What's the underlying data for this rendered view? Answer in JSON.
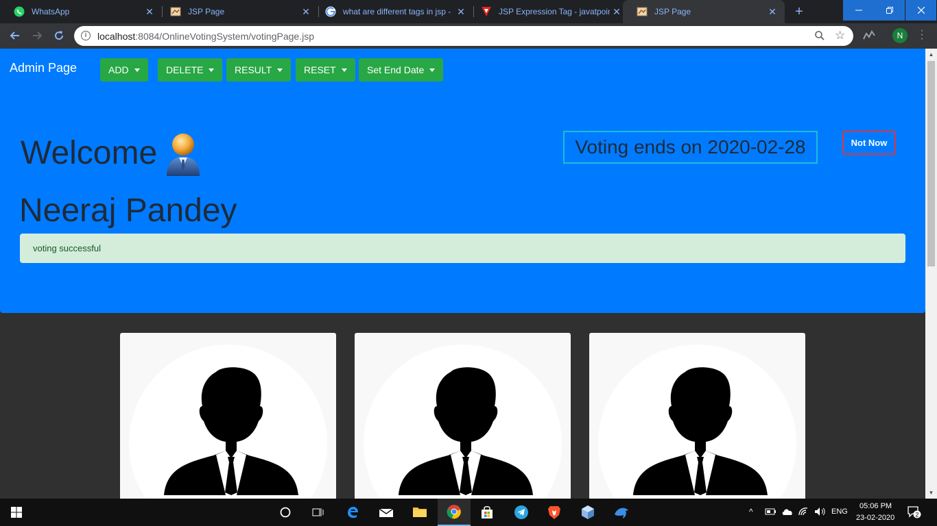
{
  "browser": {
    "tabs": [
      {
        "title": "WhatsApp",
        "favicon": "whatsapp-icon",
        "active": false
      },
      {
        "title": "JSP Page",
        "favicon": "jsp-page-icon",
        "active": false
      },
      {
        "title": "what are different tags in jsp -",
        "favicon": "google-icon",
        "active": false
      },
      {
        "title": "JSP Expression Tag - javatpoint",
        "favicon": "javatpoint-icon",
        "active": false
      },
      {
        "title": "JSP Page",
        "favicon": "jsp-page-icon",
        "active": true
      }
    ],
    "url_host": "localhost",
    "url_path": ":8084/OnlineVotingSystem/votingPage.jsp",
    "profile_initial": "N"
  },
  "page": {
    "brand": "Admin Page",
    "menus": [
      "ADD",
      "DELETE",
      "RESULT",
      "RESET",
      "Set End Date"
    ],
    "welcome": "Welcome",
    "user_name": "Neeraj Pandey",
    "voting_ends": "Voting ends on 2020-02-28",
    "not_now": "Not Now",
    "alert": "voting successful",
    "colors": {
      "header_blue": "#007bff",
      "menu_green": "#28a745",
      "alert_bg": "#d4edda",
      "alert_text": "#155724",
      "ends_border": "#17c0d8",
      "not_now_border": "#dc3545",
      "page_bg": "#303030"
    }
  },
  "taskbar": {
    "language": "ENG",
    "time": "05:06 PM",
    "date": "23-02-2020",
    "notification_count": "2"
  }
}
